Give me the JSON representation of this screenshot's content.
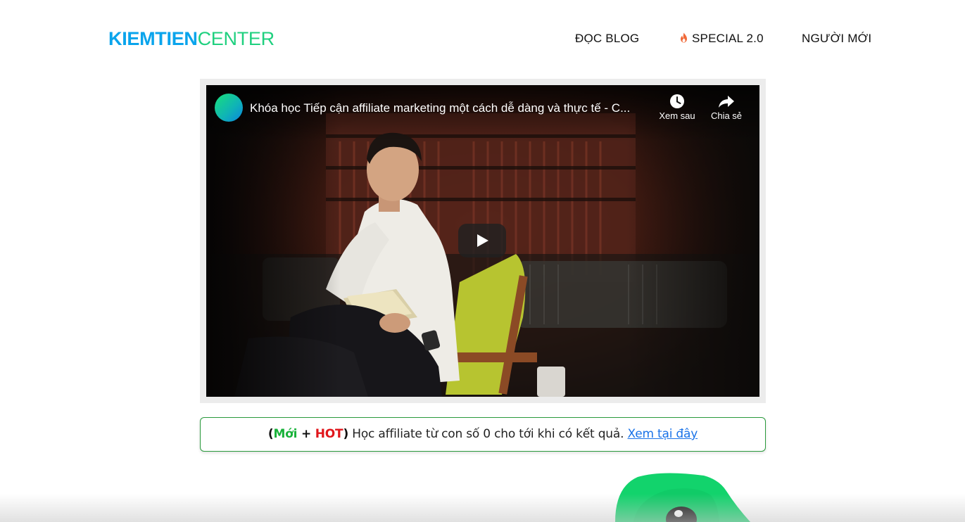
{
  "header": {
    "logo_bold": "KIEMTIEN",
    "logo_light": "CENTER",
    "nav": [
      {
        "label": "ĐỌC BLOG"
      },
      {
        "label": "SPECIAL 2.0",
        "icon": "flame-icon"
      },
      {
        "label": "NGƯỜI MỚI"
      }
    ]
  },
  "video": {
    "title": "Khóa học Tiếp cận affiliate marketing một cách dễ dàng và thực tế - C...",
    "watch_later_label": "Xem sau",
    "share_label": "Chia sẻ",
    "play_icon": "play-icon"
  },
  "notice": {
    "open_paren": "(",
    "new_label": "Mới",
    "plus": " + ",
    "hot_label": "HOT",
    "close_paren": ")",
    "text": " Học affiliate từ con số 0 cho tới khi có kết quả. ",
    "link_label": "Xem tại đây"
  },
  "colors": {
    "logo_blue": "#0aa4ec",
    "logo_green": "#1fd07f",
    "new_green": "#19b23a",
    "hot_red": "#e0161b",
    "link_blue": "#1a73e8",
    "notice_border": "#2a9a3c"
  }
}
